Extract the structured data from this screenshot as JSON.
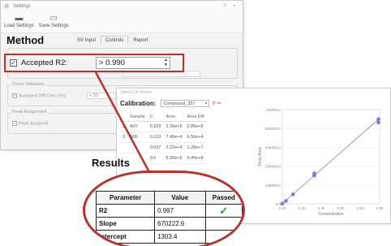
{
  "settings": {
    "title": "Settings",
    "controls": {
      "help": "?",
      "close": "×"
    },
    "toolbar": {
      "load_label": "Load Settings",
      "save_label": "Save Settings"
    },
    "tabs": [
      {
        "label": "SV Input"
      },
      {
        "label": "Controls"
      },
      {
        "label": "Report"
      }
    ],
    "cross_validation": {
      "group_label": "Cross Validation",
      "accepted_diff_label": "Accepted Diff Conc (%):",
      "accepted_diff_value": "< 20"
    },
    "peak_assignment": {
      "group_label": "Peak Assignment",
      "peak_assigned_label": "Peak Assigned"
    },
    "accepted_r2": {
      "label": "Accepted R2:",
      "value": "> 0.990",
      "checked": true
    }
  },
  "method_label": "Method",
  "viewer": {
    "title": "Select Cal Viewer",
    "calibration_label": "Calibration:",
    "compound": "Compound_357",
    "columns": [
      "Sample",
      "C",
      "Area",
      "Area Diff"
    ],
    "rows": [
      {
        "num": "2",
        "sample": "A07",
        "c": "0.329",
        "area": "2.39e+5",
        "diff": "2.89e+8"
      },
      {
        "num": "3",
        "sample": "A06",
        "c": "0.110",
        "area": "7.45e+4",
        "diff": "6.56e+4"
      },
      {
        "num": "",
        "sample": "",
        "c": "0.037",
        "area": "2.22e+4",
        "diff": "1.28e+7"
      },
      {
        "num": "",
        "sample": "",
        "c": "0.0",
        "area": "6.39e+5",
        "diff": "5.40e+8"
      }
    ]
  },
  "chart_data": {
    "type": "scatter",
    "xlabel": "Concentration",
    "ylabel": "Peak Area",
    "xlim": [
      0,
      1.0
    ],
    "ylim": [
      0,
      740000
    ],
    "x_ticks": [
      "0.00",
      "0.20",
      "0.40",
      "0.60",
      "0.80",
      "1.00"
    ],
    "y_ticks": [
      "740000.0",
      "592000.0",
      "444000.0",
      "296000.0",
      "148000.0",
      "0.0"
    ],
    "points": [
      {
        "x": 0.0,
        "y": 1300
      },
      {
        "x": 0.037,
        "y": 22000
      },
      {
        "x": 0.11,
        "y": 74500
      },
      {
        "x": 0.329,
        "y": 222000
      },
      {
        "x": 0.329,
        "y": 239000
      },
      {
        "x": 0.988,
        "y": 639000
      },
      {
        "x": 0.988,
        "y": 665000
      }
    ],
    "fit": {
      "slope": 670222.6,
      "intercept": 1303.4
    }
  },
  "results_label": "Results",
  "results": {
    "columns": [
      "Parameter",
      "Value",
      "Passed"
    ],
    "rows": [
      {
        "name": "R2",
        "value": "0.997",
        "passed": "✓"
      },
      {
        "name": "Slope",
        "value": "670222.6",
        "passed": ""
      },
      {
        "name": "Intercept",
        "value": "1303.4",
        "passed": ""
      }
    ]
  },
  "colors": {
    "highlight": "#b9322e",
    "pass": "#1f9d2e",
    "points": "#7b7fd6"
  }
}
